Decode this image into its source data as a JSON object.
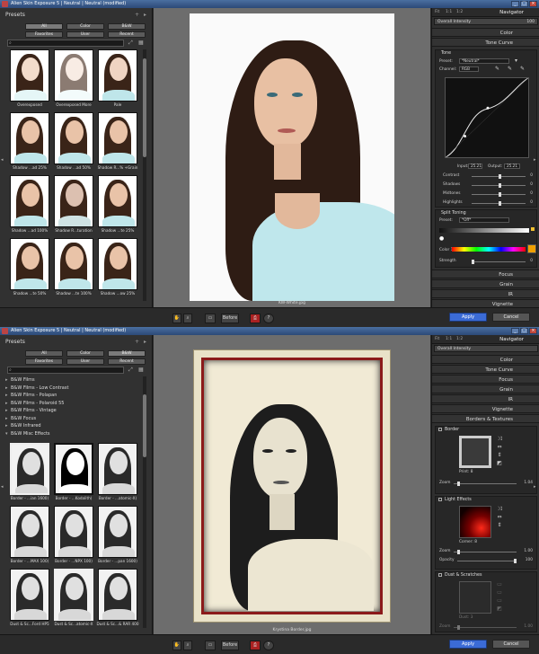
{
  "window1": {
    "title": "Alien Skin Exposure 5  |  Neutral  |  Neutral (modified)",
    "presets_title": "Presets",
    "categories": [
      "All",
      "Color",
      "B&W",
      "Favorites",
      "User",
      "Recent"
    ],
    "thumbs": [
      {
        "label": "Overexposed"
      },
      {
        "label": "Overexposed More"
      },
      {
        "label": "Pale"
      },
      {
        "label": "Shadow ...ad  25%"
      },
      {
        "label": "Shadow ...ad  50%"
      },
      {
        "label": "Shadow R...% +Grain"
      },
      {
        "label": "Shadow ...ad 100%"
      },
      {
        "label": "Shadow R...turation"
      },
      {
        "label": "Shadow ...te  25%"
      },
      {
        "label": "Shadow ...te  50%"
      },
      {
        "label": "Shadow ...te 100%"
      },
      {
        "label": "Shadow ...ow  25%"
      }
    ],
    "filename": "KW-White.jpg",
    "navigator": {
      "title": "Navigator",
      "zoom_fit": "Fit",
      "zoom_1": "1:1",
      "zoom_2": "1:2"
    },
    "overall_intensity": {
      "label": "Overall Intensity",
      "value": "100"
    },
    "sections_top": [
      "Color",
      "Tone Curve"
    ],
    "tone": {
      "title": "Tone",
      "preset_label": "Preset:",
      "preset_value": "*Neutral*",
      "channel_label": "Channel:",
      "channel_value": "RGB",
      "input_label": "Input:",
      "input_value": "25.21",
      "output_label": "Output:",
      "output_value": "25.21",
      "sliders": [
        {
          "label": "Contrast",
          "value": "0"
        },
        {
          "label": "Shadows",
          "value": "0"
        },
        {
          "label": "Midtones",
          "value": "0"
        },
        {
          "label": "Highlights",
          "value": "0"
        }
      ]
    },
    "split": {
      "title": "Split Toning",
      "preset_label": "Preset:",
      "preset_value": "*Off*",
      "color_label": "Color 1",
      "strength_label": "Strength",
      "strength_value": "0"
    },
    "sections_bottom": [
      "Focus",
      "Grain",
      "IR",
      "Vignette"
    ]
  },
  "window2": {
    "title": "Alien Skin Exposure 5  |  Neutral  |  Neutral (modified)",
    "presets_title": "Presets",
    "categories": [
      "All",
      "Color",
      "B&W",
      "Favorites",
      "User",
      "Recent"
    ],
    "tree": [
      "B&W Films",
      "B&W Films - Low Contrast",
      "B&W Films - Polapan",
      "B&W Films - Polaroid 55",
      "B&W Films - Vintage",
      "B&W Focus",
      "B&W Infrared",
      "B&W Misc Effects"
    ],
    "thumbs": [
      {
        "label": "Border - ...ian 1600)"
      },
      {
        "label": "Border - ...Kodalith)"
      },
      {
        "label": "Border - ...atomic-X)"
      },
      {
        "label": "Border - ...MAX 100)"
      },
      {
        "label": "Border - ...NPX 100)"
      },
      {
        "label": "Border - ...pan 1600)"
      },
      {
        "label": "Dust & Sc...Ford HP5"
      },
      {
        "label": "Dust & Sc...atomic-X"
      },
      {
        "label": "Dust & Sc...& RAR 400"
      }
    ],
    "filename": "Krystina Border.jpg",
    "navigator": {
      "title": "Navigator",
      "zoom_fit": "Fit",
      "zoom_1": "1:1",
      "zoom_2": "1:2"
    },
    "overall_intensity": {
      "label": "Overall Intensity",
      "value": ""
    },
    "sections": [
      "Color",
      "Tone Curve",
      "Focus",
      "Grain",
      "IR",
      "Vignette",
      "Borders & Textures"
    ],
    "border": {
      "title": "Border",
      "print_label": "Print: 8",
      "zoom_label": "Zoom",
      "zoom_value": "1.04"
    },
    "light": {
      "title": "Light Effects",
      "corner_label": "Corner: 8",
      "zoom_label": "Zoom",
      "zoom_value": "1.00",
      "opacity_label": "Opacity",
      "opacity_value": "100"
    },
    "dust": {
      "title": "Dust & Scratches",
      "dust_label": "Dust: 3",
      "zoom_label": "Zoom",
      "zoom_value": "1.00"
    }
  },
  "toolbar": {
    "before_label": "Before",
    "apply_label": "Apply",
    "cancel_label": "Cancel"
  },
  "colors": {
    "accent": "#3b6bd6",
    "panel": "#2f2f2f",
    "canvas": "#6d6d6d"
  }
}
